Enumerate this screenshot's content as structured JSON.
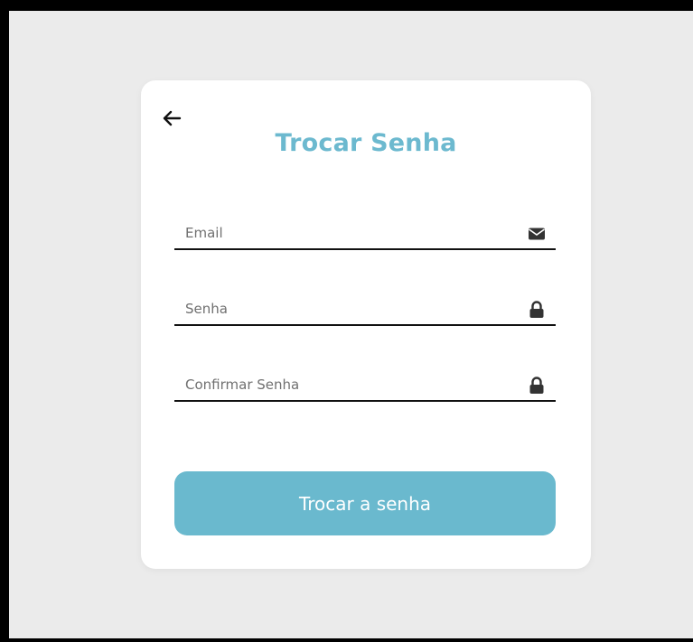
{
  "form": {
    "title": "Trocar Senha",
    "fields": [
      {
        "placeholder": "Email",
        "value": "",
        "icon": "envelope-icon"
      },
      {
        "placeholder": "Senha",
        "value": "",
        "icon": "lock-icon"
      },
      {
        "placeholder": "Confirmar Senha",
        "value": "",
        "icon": "lock-icon"
      }
    ],
    "submit_label": "Trocar a senha",
    "back_icon": "arrow-left-icon"
  },
  "colors": {
    "accent": "#6cb9cf",
    "background": "#ebebeb",
    "card": "#ffffff",
    "frame": "#000000"
  }
}
